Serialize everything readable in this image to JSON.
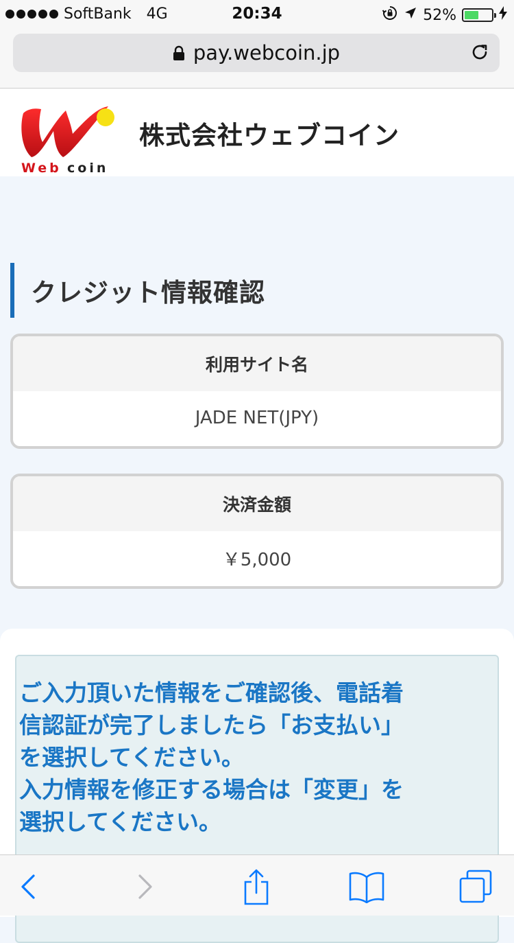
{
  "status_bar": {
    "carrier": "SoftBank",
    "network": "4G",
    "time": "20:34",
    "battery_percent": "52%",
    "battery_level": 0.52
  },
  "address_bar": {
    "url": "pay.webcoin.jp"
  },
  "header": {
    "logo_text": "Web coin",
    "company_name": "株式会社ウェブコイン"
  },
  "page": {
    "title": "クレジット情報確認"
  },
  "cards": {
    "site": {
      "label": "利用サイト名",
      "value": "JADE NET(JPY)"
    },
    "amount": {
      "label": "決済金額",
      "value": "￥5,000"
    }
  },
  "notice": {
    "lines": [
      "ご入力頂いた情報をご確認後、電話着",
      "信認証が完了しましたら「お支払い」",
      "を選択してください。",
      "入力情報を修正する場合は「変更」を",
      "選択してください。"
    ]
  },
  "toolbar": {
    "icons": [
      "back-icon",
      "forward-icon",
      "share-icon",
      "bookmarks-icon",
      "tabs-icon"
    ]
  },
  "colors": {
    "accent": "#1a6db8",
    "notice_text": "#1a76c5",
    "logo_red": "#d4151b",
    "logo_yellow": "#f6e115",
    "ios_blue": "#0a7aff"
  }
}
